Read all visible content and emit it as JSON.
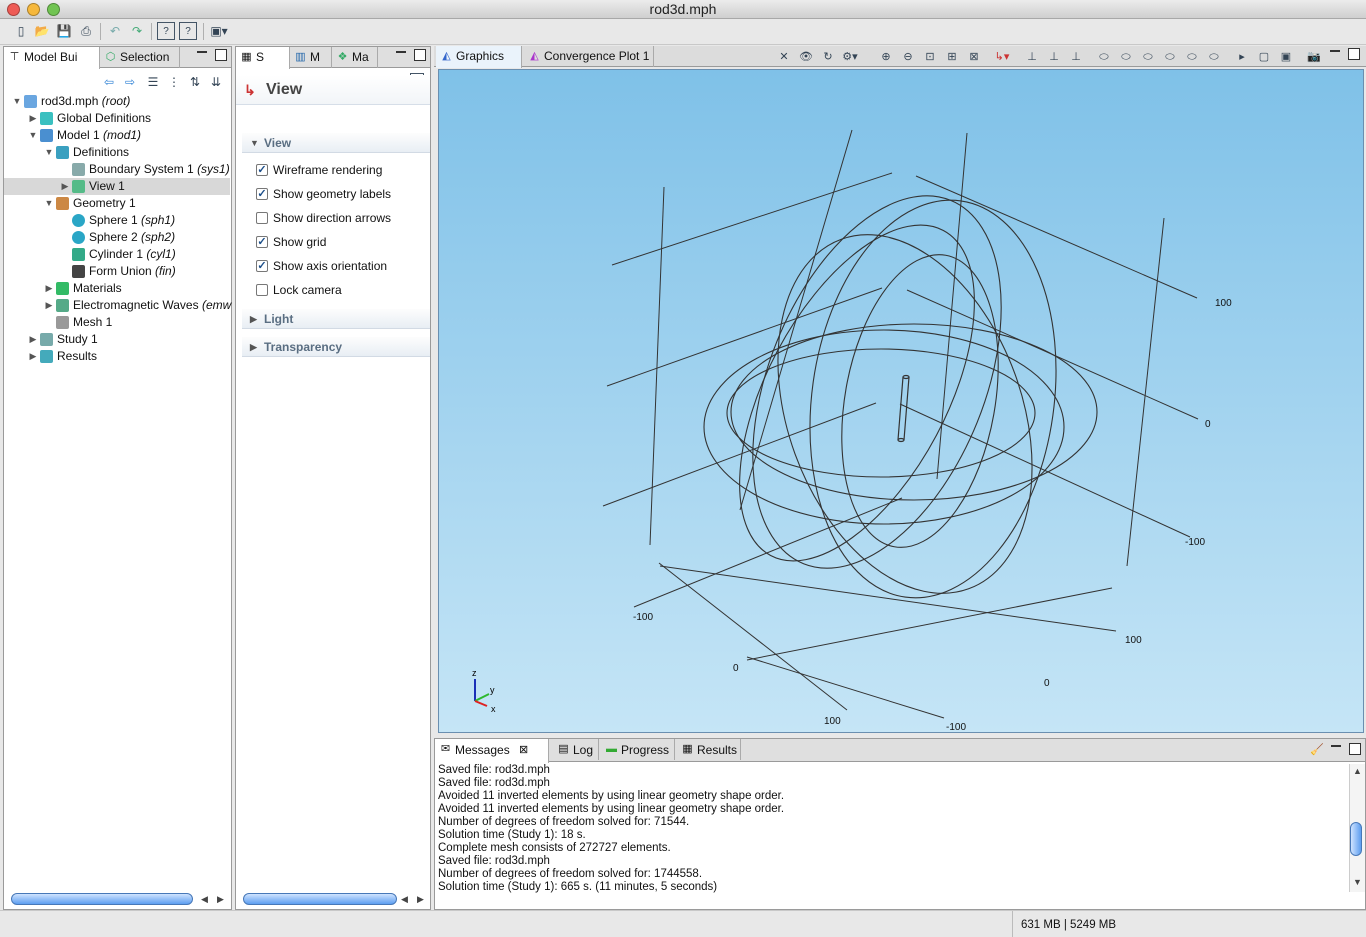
{
  "window": {
    "title": "rod3d.mph"
  },
  "model_builder": {
    "tabs": [
      {
        "label": "Model Bui",
        "icon": "model-tree-icon"
      },
      {
        "label": "Selection",
        "icon": "selection-icon"
      }
    ],
    "tree": [
      {
        "label": "rod3d.mph",
        "tag": "(root)",
        "arrow": "▼",
        "icon": "file-icon"
      },
      {
        "label": "Global Definitions",
        "tag": "",
        "arrow": "▶",
        "icon": "global-definitions-icon"
      },
      {
        "label": "Model 1",
        "tag": "(mod1)",
        "arrow": "▼",
        "icon": "model-icon"
      },
      {
        "label": "Definitions",
        "tag": "",
        "arrow": "▼",
        "icon": "definitions-icon"
      },
      {
        "label": "Boundary System 1",
        "tag": "(sys1)",
        "arrow": "",
        "icon": "boundary-system-icon"
      },
      {
        "label": "View 1",
        "tag": "",
        "arrow": "▶",
        "icon": "view-icon"
      },
      {
        "label": "Geometry 1",
        "tag": "",
        "arrow": "▼",
        "icon": "geometry-icon"
      },
      {
        "label": "Sphere 1",
        "tag": "(sph1)",
        "arrow": "",
        "icon": "sphere-icon"
      },
      {
        "label": "Sphere 2",
        "tag": "(sph2)",
        "arrow": "",
        "icon": "sphere-icon"
      },
      {
        "label": "Cylinder 1",
        "tag": "(cyl1)",
        "arrow": "",
        "icon": "cylinder-icon"
      },
      {
        "label": "Form Union",
        "tag": "(fin)",
        "arrow": "",
        "icon": "form-union-icon"
      },
      {
        "label": "Materials",
        "tag": "",
        "arrow": "▶",
        "icon": "materials-icon"
      },
      {
        "label": "Electromagnetic Waves",
        "tag": "(emw",
        "arrow": "▶",
        "icon": "em-waves-icon"
      },
      {
        "label": "Mesh 1",
        "tag": "",
        "arrow": "",
        "icon": "mesh-icon"
      },
      {
        "label": "Study 1",
        "tag": "",
        "arrow": "▶",
        "icon": "study-icon"
      },
      {
        "label": "Results",
        "tag": "",
        "arrow": "▶",
        "icon": "results-icon"
      }
    ]
  },
  "settings": {
    "tabs": [
      {
        "label": "S"
      },
      {
        "label": "M"
      },
      {
        "label": "Ma"
      }
    ],
    "title": "View",
    "section_view": "View",
    "options": [
      {
        "label": "Wireframe rendering",
        "checked": true,
        "mark": "✓"
      },
      {
        "label": "Show geometry labels",
        "checked": true,
        "mark": "✓"
      },
      {
        "label": "Show direction arrows",
        "checked": false,
        "mark": ""
      },
      {
        "label": "Show grid",
        "checked": true,
        "mark": "✓"
      },
      {
        "label": "Show axis orientation",
        "checked": true,
        "mark": "✓"
      },
      {
        "label": "Lock camera",
        "checked": false,
        "mark": ""
      }
    ],
    "section_light": "Light",
    "section_transparency": "Transparency"
  },
  "graphics": {
    "tabs": [
      {
        "label": "Graphics"
      },
      {
        "label": "Convergence Plot 1"
      }
    ],
    "grid_labels": [
      "100",
      "0",
      "-100",
      "-100",
      "0",
      "100",
      "100",
      "0",
      "-100"
    ],
    "axis_labels": {
      "z": "z",
      "y": "y",
      "x": "x"
    },
    "bg_top": "#7fc1e8",
    "bg_bottom": "#c5e5f6"
  },
  "messages": {
    "tabs": [
      {
        "label": "Messages"
      },
      {
        "label": "Log"
      },
      {
        "label": "Progress"
      },
      {
        "label": "Results"
      }
    ],
    "lines": [
      "Saved file: rod3d.mph",
      "Saved file: rod3d.mph",
      "Avoided 11 inverted elements by using linear geometry shape order.",
      "Avoided 11 inverted elements by using linear geometry shape order.",
      "Number of degrees of freedom solved for: 71544.",
      "Solution time (Study 1): 18 s.",
      "Complete mesh consists of 272727 elements.",
      "Saved file: rod3d.mph",
      "Number of degrees of freedom solved for: 1744558.",
      "Solution time (Study 1): 665 s. (11 minutes, 5 seconds)"
    ]
  },
  "status": {
    "memory": "631 MB | 5249 MB"
  }
}
